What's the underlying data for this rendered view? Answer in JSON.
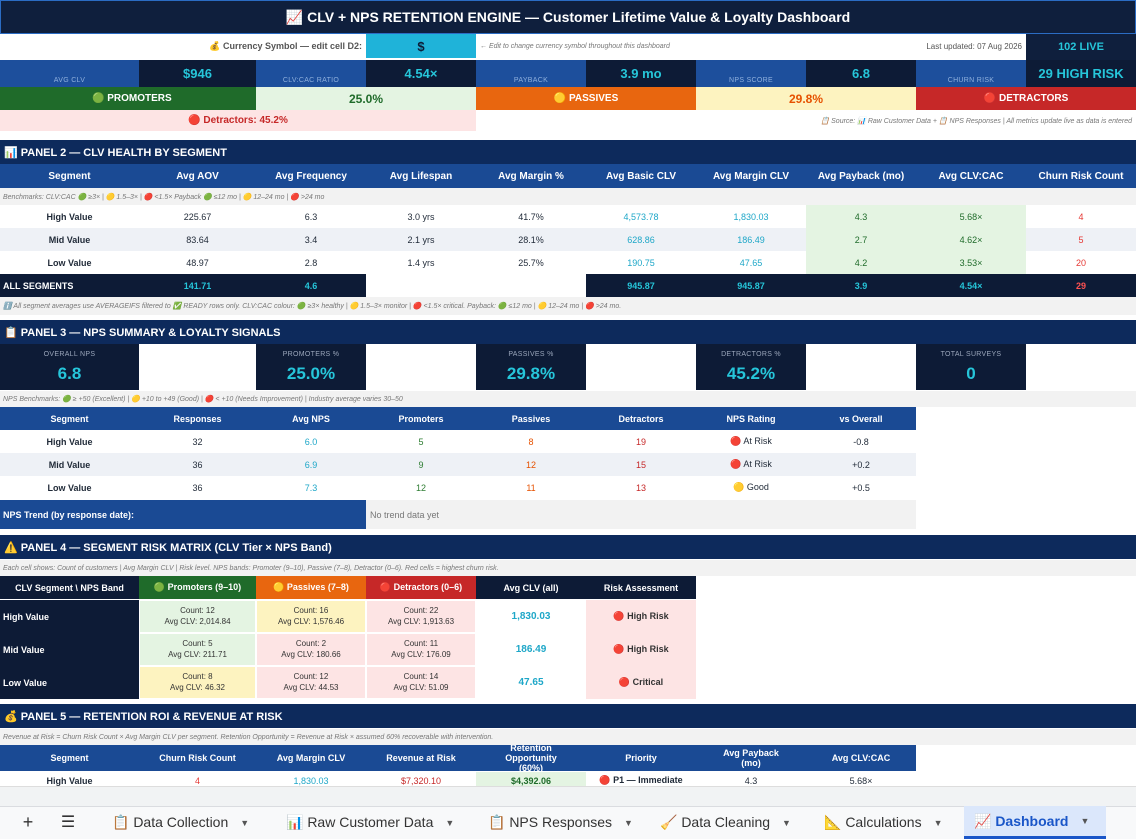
{
  "title": "📈 CLV + NPS RETENTION ENGINE  —  Customer Lifetime Value & Loyalty Dashboard",
  "currency": {
    "label": "💰 Currency Symbol — edit cell D2:",
    "value": "$",
    "note": "← Edit to change currency symbol throughout this dashboard",
    "last_updated": "Last updated: 07 Aug 2026",
    "live": "102 LIVE"
  },
  "kpis": {
    "avg_clv_label": "AVG CLV",
    "avg_clv": "$946",
    "ratio_label": "CLV:CAC RATIO",
    "ratio": "4.54×",
    "payback_label": "PAYBACK",
    "payback": "3.9 mo",
    "nps_label": "NPS SCORE",
    "nps": "6.8",
    "churn_label": "CHURN RISK",
    "churn": "29 HIGH RISK"
  },
  "bands": {
    "promoters_label": "🟢 PROMOTERS",
    "promoters": "25.0%",
    "passives_label": "🟡 PASSIVES",
    "passives": "29.8%",
    "detractors_label": "🔴 DETRACTORS",
    "detractors_note": "🔴 Detractors: 45.2%",
    "source_note": "📋 Source: 📊 Raw Customer Data + 📋 NPS Responses  |  All metrics update live as data is entered"
  },
  "panel2": {
    "title": "📊 PANEL 2 — CLV HEALTH BY SEGMENT",
    "headers": [
      "Segment",
      "Avg AOV",
      "Avg Frequency",
      "Avg Lifespan",
      "Avg Margin %",
      "Avg Basic CLV",
      "Avg Margin CLV",
      "Avg Payback (mo)",
      "Avg CLV:CAC",
      "Churn Risk Count"
    ],
    "benchmarks": "Benchmarks:  CLV:CAC  🟢 ≥3×  |  🟡 1.5–3×  |  🔴 <1.5×     Payback  🟢 ≤12 mo  |  🟡 12–24 mo  |  🔴 >24 mo",
    "rows": [
      [
        "High Value",
        "225.67",
        "6.3",
        "3.0 yrs",
        "41.7%",
        "4,573.78",
        "1,830.03",
        "4.3",
        "5.68×",
        "4"
      ],
      [
        "Mid Value",
        "83.64",
        "3.4",
        "2.1 yrs",
        "28.1%",
        "628.86",
        "186.49",
        "2.7",
        "4.62×",
        "5"
      ],
      [
        "Low Value",
        "48.97",
        "2.8",
        "1.4 yrs",
        "25.7%",
        "190.75",
        "47.65",
        "4.2",
        "3.53×",
        "20"
      ]
    ],
    "total": [
      "ALL SEGMENTS",
      "141.71",
      "4.6",
      "",
      "",
      "945.87",
      "945.87",
      "3.9",
      "4.54×",
      "29"
    ],
    "footnote": "ℹ️ All segment averages use AVERAGEIFS filtered to ✅ READY rows only. CLV:CAC colour: 🟢 ≥3× healthy | 🟡 1.5–3× monitor | 🔴 <1.5× critical. Payback: 🟢 ≤12 mo | 🟡 12–24 mo | 🔴 >24 mo."
  },
  "panel3": {
    "title": "📋 PANEL 3 — NPS SUMMARY & LOYALTY SIGNALS",
    "overall_label": "OVERALL NPS",
    "overall": "6.8",
    "prom_label": "PROMOTERS %",
    "prom": "25.0%",
    "pass_label": "PASSIVES %",
    "pass": "29.8%",
    "det_label": "DETRACTORS %",
    "det": "45.2%",
    "surveys_label": "TOTAL SURVEYS",
    "surveys": "0",
    "benchmarks": "NPS Benchmarks:  🟢 ≥ +50 (Excellent)  |  🟡 +10 to +49 (Good)  |  🔴 < +10 (Needs Improvement)  |  Industry average varies 30–50",
    "headers": [
      "Segment",
      "Responses",
      "Avg NPS",
      "Promoters",
      "Passives",
      "Detractors",
      "NPS Rating",
      "vs Overall"
    ],
    "rows": [
      [
        "High Value",
        "32",
        "6.0",
        "5",
        "8",
        "19",
        "🔴 At Risk",
        "-0.8"
      ],
      [
        "Mid Value",
        "36",
        "6.9",
        "9",
        "12",
        "15",
        "🔴 At Risk",
        "+0.2"
      ],
      [
        "Low Value",
        "36",
        "7.3",
        "12",
        "11",
        "13",
        "🟡 Good",
        "+0.5"
      ]
    ],
    "trend_label": "NPS Trend (by response date):",
    "trend_value": "No trend data yet"
  },
  "panel4": {
    "title": "⚠️ PANEL 4 — SEGMENT RISK MATRIX  (CLV Tier × NPS Band)",
    "note": "Each cell shows: Count of customers  |  Avg Margin CLV  |  Risk level. NPS bands: Promoter (9–10), Passive (7–8), Detractor (0–6). Red cells = highest churn risk.",
    "headers": [
      "CLV Segment \\ NPS Band",
      "🟢 Promoters (9–10)",
      "🟡 Passives (7–8)",
      "🔴 Detractors (0–6)",
      "Avg CLV (all)",
      "Risk Assessment"
    ],
    "rows": [
      {
        "seg": "High Value",
        "p1": "Count: 12",
        "p2": "Avg CLV: 2,014.84",
        "q1": "Count: 16",
        "q2": "Avg CLV: 1,576.46",
        "d1": "Count: 22",
        "d2": "Avg CLV: 1,913.63",
        "avg": "1,830.03",
        "risk": "🔴 High Risk"
      },
      {
        "seg": "Mid Value",
        "p1": "Count: 5",
        "p2": "Avg CLV: 211.71",
        "q1": "Count: 2",
        "q2": "Avg CLV: 180.66",
        "d1": "Count: 11",
        "d2": "Avg CLV: 176.09",
        "avg": "186.49",
        "risk": "🔴 High Risk"
      },
      {
        "seg": "Low Value",
        "p1": "Count: 8",
        "p2": "Avg CLV: 46.32",
        "q1": "Count: 12",
        "q2": "Avg CLV: 44.53",
        "d1": "Count: 14",
        "d2": "Avg CLV: 51.09",
        "avg": "47.65",
        "risk": "🔴 Critical"
      }
    ]
  },
  "panel5": {
    "title": "💰 PANEL 5 — RETENTION ROI & REVENUE AT RISK",
    "note": "Revenue at Risk = Churn Risk Count × Avg Margin CLV per segment.  Retention Opportunity = Revenue at Risk × assumed 60% recoverable with intervention.",
    "headers": [
      "Segment",
      "Churn Risk Count",
      "Avg Margin CLV",
      "Revenue at Risk",
      "Retention Opportunity (60%)",
      "Priority",
      "Avg Payback (mo)",
      "Avg CLV:CAC"
    ],
    "row": [
      "High Value",
      "4",
      "1,830.03",
      "$7,320.10",
      "$4,392.06",
      "🔴 P1 — Immediate",
      "4.3",
      "5.68×"
    ]
  },
  "tabs": [
    {
      "label": "📋 Data Collection"
    },
    {
      "label": "📊 Raw Customer Data"
    },
    {
      "label": "📋 NPS Responses"
    },
    {
      "label": "🧹 Data Cleaning"
    },
    {
      "label": "📐 Calculations"
    },
    {
      "label": "📈 Dashboard"
    }
  ],
  "colors": {
    "accent": "#26c6da",
    "navy": "#0f1f3d",
    "header_blue": "#1a4a94"
  }
}
